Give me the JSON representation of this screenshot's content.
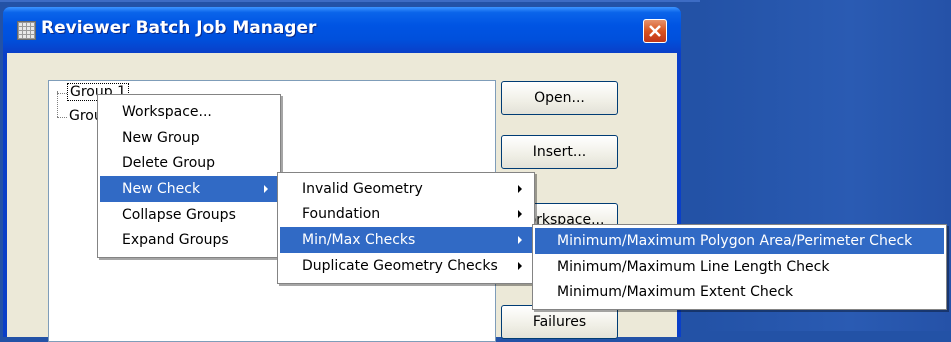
{
  "window": {
    "title": "Reviewer Batch Job Manager"
  },
  "tree": {
    "items": [
      {
        "label": "Group 1"
      },
      {
        "label": "Group 2"
      }
    ]
  },
  "buttons": [
    {
      "label": "Open..."
    },
    {
      "label": "Insert..."
    },
    {
      "label": "Workspace..."
    },
    {
      "label": "Failures"
    }
  ],
  "context_menu": {
    "items": [
      {
        "label": "Workspace..."
      },
      {
        "label": "New Group"
      },
      {
        "label": "Delete Group"
      },
      {
        "label": "New Check"
      },
      {
        "label": "Collapse Groups"
      },
      {
        "label": "Expand Groups"
      }
    ],
    "highlighted": "New Check"
  },
  "check_submenu": {
    "items": [
      {
        "label": "Invalid Geometry"
      },
      {
        "label": "Foundation"
      },
      {
        "label": "Min/Max Checks"
      },
      {
        "label": "Duplicate Geometry Checks"
      }
    ],
    "highlighted": "Min/Max Checks"
  },
  "minmax_submenu": {
    "items": [
      {
        "label": "Minimum/Maximum Polygon Area/Perimeter Check"
      },
      {
        "label": "Minimum/Maximum Line Length Check"
      },
      {
        "label": "Minimum/Maximum Extent Check"
      }
    ],
    "highlighted": "Minimum/Maximum Polygon Area/Perimeter Check"
  },
  "colors": {
    "desktop": "#2352a6",
    "titlebar": "#0054e3",
    "menu_highlight": "#316ac5",
    "close_button": "#d9541f"
  },
  "icons": [
    "window-app-icon",
    "close-icon",
    "submenu-arrow-icon"
  ]
}
